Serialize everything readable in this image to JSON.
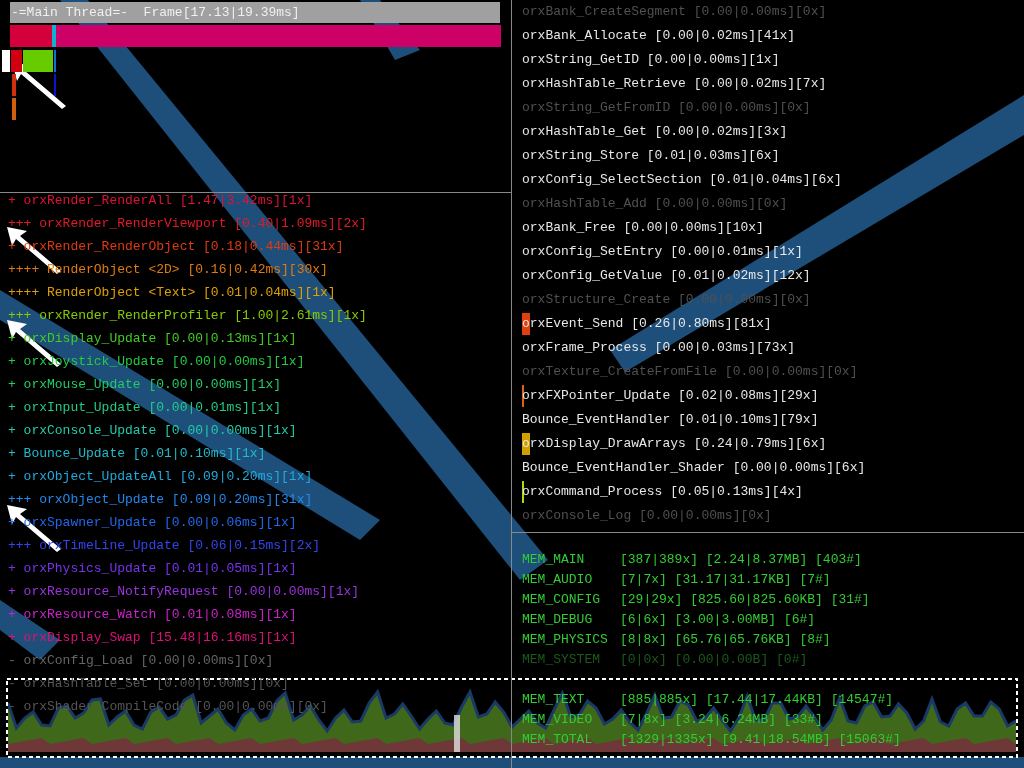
{
  "header": {
    "title": "-=Main Thread=-  Frame[17.13|19.39ms]"
  },
  "markers": [
    {
      "text": "+ orxRender_RenderAll [1.47|3.42ms][1x]",
      "color": "#e0103a"
    },
    {
      "text": "+++ orxRender_RenderViewport [0.40|1.09ms][2x]",
      "color": "#e01a28"
    },
    {
      "text": "+ orxRender_RenderObject [0.18|0.44ms][31x]",
      "color": "#e03a12"
    },
    {
      "text": "++++ RenderObject <2D> [0.16|0.42ms][30x]",
      "color": "#e07a10"
    },
    {
      "text": "++++ RenderObject <Text> [0.01|0.04ms][1x]",
      "color": "#e0a000"
    },
    {
      "text": "+++ orxRender_RenderProfiler [1.00|2.61ms][1x]",
      "color": "#88cc00"
    },
    {
      "text": "+ orxDisplay_Update [0.00|0.13ms][1x]",
      "color": "#44cc22"
    },
    {
      "text": "+ orxJoystick_Update [0.00|0.00ms][1x]",
      "color": "#22cc44"
    },
    {
      "text": "+ orxMouse_Update [0.00|0.00ms][1x]",
      "color": "#22cc66"
    },
    {
      "text": "+ orxInput_Update [0.00|0.01ms][1x]",
      "color": "#22cc88"
    },
    {
      "text": "+ orxConsole_Update [0.00|0.00ms][1x]",
      "color": "#22ccaa"
    },
    {
      "text": "+ Bounce_Update [0.01|0.10ms][1x]",
      "color": "#22bbcc"
    },
    {
      "text": "+ orxObject_UpdateAll [0.09|0.20ms][1x]",
      "color": "#22aadd"
    },
    {
      "text": "+++ orxObject_Update [0.09|0.20ms][31x]",
      "color": "#2288ee"
    },
    {
      "text": "+ orxSpawner_Update [0.00|0.06ms][1x]",
      "color": "#2266ee"
    },
    {
      "text": "+++ orxTimeLine_Update [0.06|0.15ms][2x]",
      "color": "#3344ee"
    },
    {
      "text": "+ orxPhysics_Update [0.01|0.05ms][1x]",
      "color": "#7733ee"
    },
    {
      "text": "+ orxResource_NotifyRequest [0.00|0.00ms][1x]",
      "color": "#9933dd"
    },
    {
      "text": "+ orxResource_Watch [0.01|0.08ms][1x]",
      "color": "#cc22cc"
    },
    {
      "text": "+ orxDisplay_Swap [15.48|16.16ms][1x]",
      "color": "#dd1177"
    },
    {
      "text": "- orxConfig_Load [0.00|0.00ms][0x]",
      "color": "#666666"
    },
    {
      "text": "- orxHashTable_Set [0.00|0.00ms][0x]",
      "color": "#555555"
    },
    {
      "text": "- orxShader_CompileCode [0.00|0.00ms][0x]",
      "color": "#555555"
    }
  ],
  "entries": [
    {
      "text": "orxBank_CreateSegment [0.00|0.00ms][0x]",
      "dim": true
    },
    {
      "text": "orxBank_Allocate [0.00|0.02ms][41x]",
      "dim": false
    },
    {
      "text": "orxString_GetID [0.00|0.00ms][1x]",
      "dim": false
    },
    {
      "text": "orxHashTable_Retrieve [0.00|0.02ms][7x]",
      "dim": false
    },
    {
      "text": "orxString_GetFromID [0.00|0.00ms][0x]",
      "dim": true
    },
    {
      "text": "orxHashTable_Get [0.00|0.02ms][3x]",
      "dim": false
    },
    {
      "text": "orxString_Store [0.01|0.03ms][6x]",
      "dim": false
    },
    {
      "text": "orxConfig_SelectSection [0.01|0.04ms][6x]",
      "dim": false
    },
    {
      "text": "orxHashTable_Add [0.00|0.00ms][0x]",
      "dim": true
    },
    {
      "text": "orxBank_Free [0.00|0.00ms][10x]",
      "dim": false
    },
    {
      "text": "orxConfig_SetEntry [0.00|0.01ms][1x]",
      "dim": false
    },
    {
      "text": "orxConfig_GetValue [0.01|0.02ms][12x]",
      "dim": false
    },
    {
      "text": "orxStructure_Create [0.00|0.00ms][0x]",
      "dim": true
    },
    {
      "text": "orxEvent_Send [0.26|0.80ms][81x]",
      "dim": false,
      "tag": {
        "kind": "block",
        "color": "#e04010"
      }
    },
    {
      "text": "orxFrame_Process [0.00|0.03ms][73x]",
      "dim": false
    },
    {
      "text": "orxTexture_CreateFromFile [0.00|0.00ms][0x]",
      "dim": true
    },
    {
      "text": "orxFXPointer_Update [0.02|0.08ms][29x]",
      "dim": false,
      "tag": {
        "kind": "line",
        "color": "#e06010"
      }
    },
    {
      "text": "Bounce_EventHandler [0.01|0.10ms][79x]",
      "dim": false
    },
    {
      "text": "orxDisplay_DrawArrays [0.24|0.79ms][6x]",
      "dim": false,
      "tag": {
        "kind": "block",
        "color": "#d0a000"
      }
    },
    {
      "text": "Bounce_EventHandler_Shader [0.00|0.00ms][6x]",
      "dim": false
    },
    {
      "text": "orxCommand_Process [0.05|0.13ms][4x]",
      "dim": false,
      "tag": {
        "kind": "line",
        "color": "#aadd00"
      }
    },
    {
      "text": "orxConsole_Log [0.00|0.00ms][0x]",
      "dim": true
    }
  ],
  "memory": [
    {
      "name": "MEM_MAIN",
      "stats": "[387|389x] [2.24|8.37MB] [403#]",
      "dim": false
    },
    {
      "name": "MEM_AUDIO",
      "stats": "[7|7x] [31.17|31.17KB] [7#]",
      "dim": false
    },
    {
      "name": "MEM_CONFIG",
      "stats": "[29|29x] [825.60|825.60KB] [31#]",
      "dim": false
    },
    {
      "name": "MEM_DEBUG",
      "stats": "[6|6x] [3.00|3.00MB] [6#]",
      "dim": false
    },
    {
      "name": "MEM_PHYSICS",
      "stats": "[8|8x] [65.76|65.76KB] [8#]",
      "dim": false
    },
    {
      "name": "MEM_SYSTEM",
      "stats": "[0|0x] [0.00|0.00B] [0#]",
      "dim": true
    },
    {
      "name": "MEM_TEXT",
      "stats": "[885|885x] [17.44|17.44KB] [14547#]",
      "dim": false,
      "gap": true
    },
    {
      "name": "MEM_VIDEO",
      "stats": "[7|8x] [3.24|6.24MB] [33#]",
      "dim": false
    },
    {
      "name": "MEM_TOTAL",
      "stats": "[1329|1335x] [9.41|18.54MB] [15063#]",
      "dim": false
    }
  ]
}
